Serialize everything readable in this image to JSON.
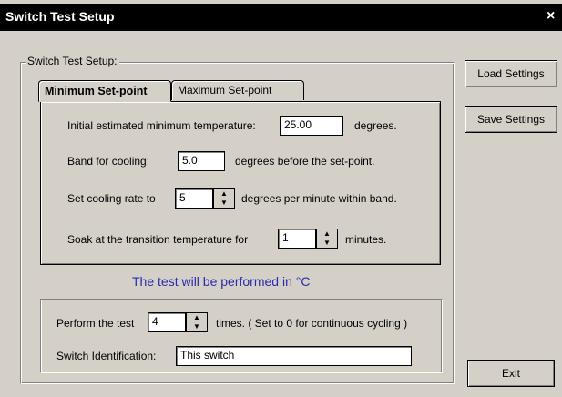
{
  "window": {
    "title": "Switch Test Setup",
    "close_glyph": "×"
  },
  "group": {
    "legend": "Switch Test Setup:"
  },
  "tabs": [
    {
      "label": "Minimum Set-point",
      "selected": true
    },
    {
      "label": "Maximum Set-point",
      "selected": false
    }
  ],
  "min_tab": {
    "initial_temp_label": "Initial estimated minimum temperature:",
    "initial_temp_value": "25.00",
    "initial_temp_unit": "degrees.",
    "band_label": "Band for cooling:",
    "band_value": "5.0",
    "band_unit": "degrees before the set-point.",
    "rate_label": "Set cooling rate to",
    "rate_value": "5",
    "rate_unit": "degrees per minute within band.",
    "soak_label": "Soak at the transition temperature for",
    "soak_value": "1",
    "soak_unit": "minutes."
  },
  "units_note": "The test will be performed in °C",
  "cycle": {
    "label": "Perform the test",
    "value": "4",
    "suffix": "times. ( Set to 0 for continuous cycling )"
  },
  "switch_id": {
    "label": "Switch Identification:",
    "value": "This switch"
  },
  "buttons": {
    "load": "Load Settings",
    "save": "Save Settings",
    "exit": "Exit"
  },
  "colors": {
    "note_text": "#2a2ab0",
    "titlebar": "#000000"
  }
}
